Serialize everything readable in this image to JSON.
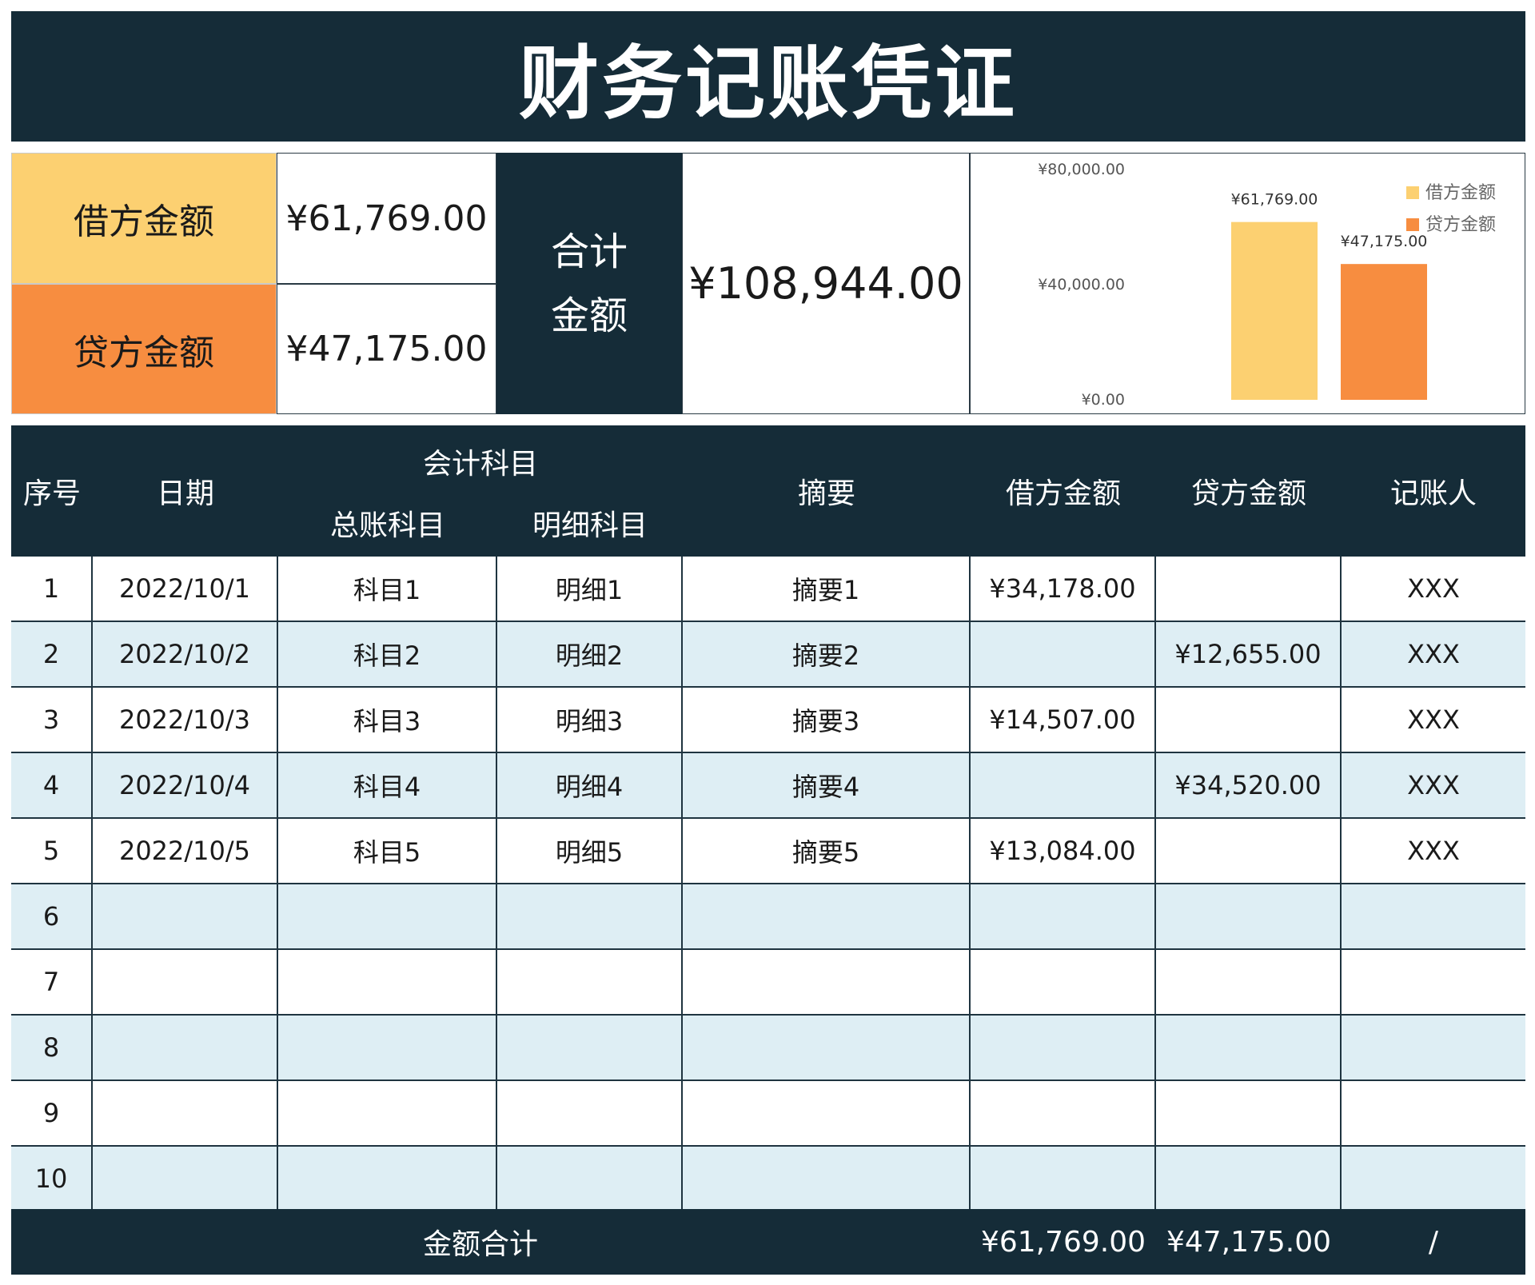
{
  "title": "财务记账凭证",
  "summary": {
    "debit_label": "借方金额",
    "debit_value": "¥61,769.00",
    "credit_label": "贷方金额",
    "credit_value": "¥47,175.00",
    "total_label_line1": "合计",
    "total_label_line2": "金额",
    "total_value": "¥108,944.00"
  },
  "colors": {
    "dark": "#152c38",
    "debit": "#fcd071",
    "credit": "#f78d40",
    "row_alt": "#deeef4"
  },
  "chart_data": {
    "type": "bar",
    "categories": [
      "借方金额",
      "贷方金额"
    ],
    "values": [
      61769,
      47175
    ],
    "data_labels": [
      "¥61,769.00",
      "¥47,175.00"
    ],
    "colors": [
      "#fcd071",
      "#f78d40"
    ],
    "ylim": [
      0,
      80000
    ],
    "yticks": [
      0,
      40000,
      80000
    ],
    "ytick_labels": [
      "¥0.00",
      "¥40,000.00",
      "¥80,000.00"
    ],
    "legend": [
      "借方金额",
      "贷方金额"
    ],
    "legend_position": "top-right",
    "grid": false
  },
  "table": {
    "headers": {
      "index": "序号",
      "date": "日期",
      "account_group": "会计科目",
      "general_account": "总账科目",
      "detail_account": "明细科目",
      "summary": "摘要",
      "debit": "借方金额",
      "credit": "贷方金额",
      "bookkeeper": "记账人"
    },
    "rows": [
      {
        "index": "1",
        "date": "2022/10/1",
        "general": "科目1",
        "detail": "明细1",
        "summary": "摘要1",
        "debit": "¥34,178.00",
        "credit": "",
        "bookkeeper": "XXX"
      },
      {
        "index": "2",
        "date": "2022/10/2",
        "general": "科目2",
        "detail": "明细2",
        "summary": "摘要2",
        "debit": "",
        "credit": "¥12,655.00",
        "bookkeeper": "XXX"
      },
      {
        "index": "3",
        "date": "2022/10/3",
        "general": "科目3",
        "detail": "明细3",
        "summary": "摘要3",
        "debit": "¥14,507.00",
        "credit": "",
        "bookkeeper": "XXX"
      },
      {
        "index": "4",
        "date": "2022/10/4",
        "general": "科目4",
        "detail": "明细4",
        "summary": "摘要4",
        "debit": "",
        "credit": "¥34,520.00",
        "bookkeeper": "XXX"
      },
      {
        "index": "5",
        "date": "2022/10/5",
        "general": "科目5",
        "detail": "明细5",
        "summary": "摘要5",
        "debit": "¥13,084.00",
        "credit": "",
        "bookkeeper": "XXX"
      },
      {
        "index": "6",
        "date": "",
        "general": "",
        "detail": "",
        "summary": "",
        "debit": "",
        "credit": "",
        "bookkeeper": ""
      },
      {
        "index": "7",
        "date": "",
        "general": "",
        "detail": "",
        "summary": "",
        "debit": "",
        "credit": "",
        "bookkeeper": ""
      },
      {
        "index": "8",
        "date": "",
        "general": "",
        "detail": "",
        "summary": "",
        "debit": "",
        "credit": "",
        "bookkeeper": ""
      },
      {
        "index": "9",
        "date": "",
        "general": "",
        "detail": "",
        "summary": "",
        "debit": "",
        "credit": "",
        "bookkeeper": ""
      },
      {
        "index": "10",
        "date": "",
        "general": "",
        "detail": "",
        "summary": "",
        "debit": "",
        "credit": "",
        "bookkeeper": ""
      }
    ]
  },
  "footer": {
    "label": "金额合计",
    "debit_total": "¥61,769.00",
    "credit_total": "¥47,175.00",
    "bookkeeper": "/"
  }
}
